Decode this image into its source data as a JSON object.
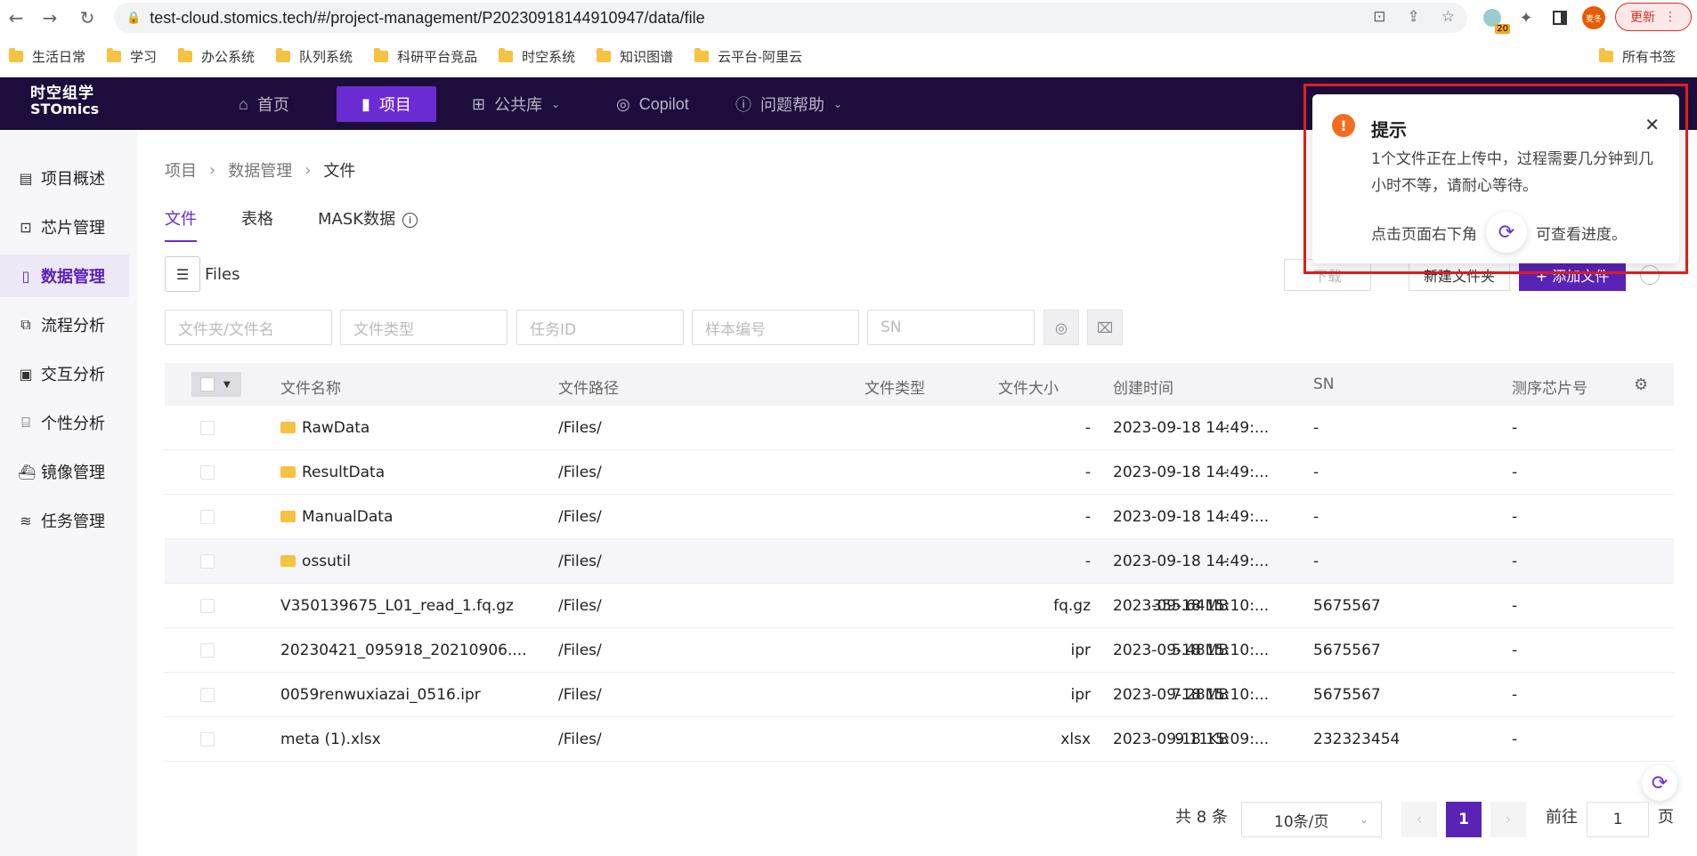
{
  "browser": {
    "url": "test-cloud.stomics.tech/#/project-management/P20230918144910947/data/file",
    "ext_badge": "20",
    "profile_name": "麦冬",
    "update_label": "更新",
    "bookmarks": [
      "生活日常",
      "学习",
      "办公系统",
      "队列系统",
      "科研平台竞品",
      "时空系统",
      "知识图谱",
      "云平台-阿里云"
    ],
    "all_bookmarks": "所有书签"
  },
  "app": {
    "logo_line1": "时空组学",
    "logo_line2": "STOmics",
    "nav": [
      {
        "label": "首页",
        "icon": "home-icon"
      },
      {
        "label": "项目",
        "icon": "document-icon"
      },
      {
        "label": "公共库",
        "icon": "grid-icon"
      },
      {
        "label": "Copilot",
        "icon": "copilot-icon"
      },
      {
        "label": "问题帮助",
        "icon": "help-icon"
      }
    ]
  },
  "sidebar": {
    "items": [
      {
        "label": "项目概述",
        "icon": "file-text-icon"
      },
      {
        "label": "芯片管理",
        "icon": "chip-icon"
      },
      {
        "label": "数据管理",
        "icon": "data-icon"
      },
      {
        "label": "流程分析",
        "icon": "flow-icon"
      },
      {
        "label": "交互分析",
        "icon": "chart-icon"
      },
      {
        "label": "个性分析",
        "icon": "code-icon"
      },
      {
        "label": "镜像管理",
        "icon": "docker-icon"
      },
      {
        "label": "任务管理",
        "icon": "layers-icon"
      }
    ]
  },
  "breadcrumb": [
    "项目",
    "数据管理",
    "文件"
  ],
  "tabs": [
    "文件",
    "表格",
    "MASK数据"
  ],
  "files_label": "Files",
  "actions": {
    "download": "下载",
    "new_folder": "新建文件夹",
    "add_file": "+ 添加文件"
  },
  "filters": {
    "name": "文件夹/文件名",
    "type": "文件类型",
    "task": "任务ID",
    "sample": "样本编号",
    "sn": "SN"
  },
  "table": {
    "headers": [
      "文件名称",
      "文件路径",
      "文件类型",
      "文件大小",
      "创建时间",
      "SN",
      "测序芯片号"
    ],
    "rows": [
      {
        "name": "RawData",
        "folder": true,
        "path": "/Files/",
        "type": "-",
        "size": "-",
        "time": "2023-09-18 14:49:...",
        "sn": "-",
        "chip": "-"
      },
      {
        "name": "ResultData",
        "folder": true,
        "path": "/Files/",
        "type": "-",
        "size": "-",
        "time": "2023-09-18 14:49:...",
        "sn": "-",
        "chip": "-"
      },
      {
        "name": "ManualData",
        "folder": true,
        "path": "/Files/",
        "type": "-",
        "size": "-",
        "time": "2023-09-18 14:49:...",
        "sn": "-",
        "chip": "-"
      },
      {
        "name": "ossutil",
        "folder": true,
        "path": "/Files/",
        "type": "-",
        "size": "-",
        "time": "2023-09-18 14:49:...",
        "sn": "-",
        "chip": "-"
      },
      {
        "name": "V350139675_L01_read_1.fq.gz",
        "folder": false,
        "path": "/Files/",
        "type": "fq.gz",
        "size": "355.64MB",
        "time": "2023-09-18 15:10:...",
        "sn": "5675567",
        "chip": "-"
      },
      {
        "name": "20230421_095918_20210906....",
        "folder": false,
        "path": "/Files/",
        "type": "ipr",
        "size": "5.48MB",
        "time": "2023-09-18 15:10:...",
        "sn": "5675567",
        "chip": "-"
      },
      {
        "name": "0059renwuxiazai_0516.ipr",
        "folder": false,
        "path": "/Files/",
        "type": "ipr",
        "size": "7.28MB",
        "time": "2023-09-18 15:10:...",
        "sn": "5675567",
        "chip": "-"
      },
      {
        "name": "meta (1).xlsx",
        "folder": false,
        "path": "/Files/",
        "type": "xlsx",
        "size": "9.11KB",
        "time": "2023-09-18 15:09:...",
        "sn": "232323454",
        "chip": "-"
      }
    ]
  },
  "pagination": {
    "total": "共 8 条",
    "page_size": "10条/页",
    "current": "1",
    "goto_label": "前往",
    "goto_value": "1",
    "page_unit": "页"
  },
  "notice": {
    "title": "提示",
    "message": "1个文件正在上传中，过程需要几分钟到几小时不等，请耐心等待。",
    "hint_before": "点击页面右下角",
    "hint_after": "可查看进度。"
  },
  "colors": {
    "accent": "#6b2bd3",
    "nav_bg": "#1c0d3c",
    "warning": "#f26d21",
    "highlight_box": "#e21f1f"
  }
}
